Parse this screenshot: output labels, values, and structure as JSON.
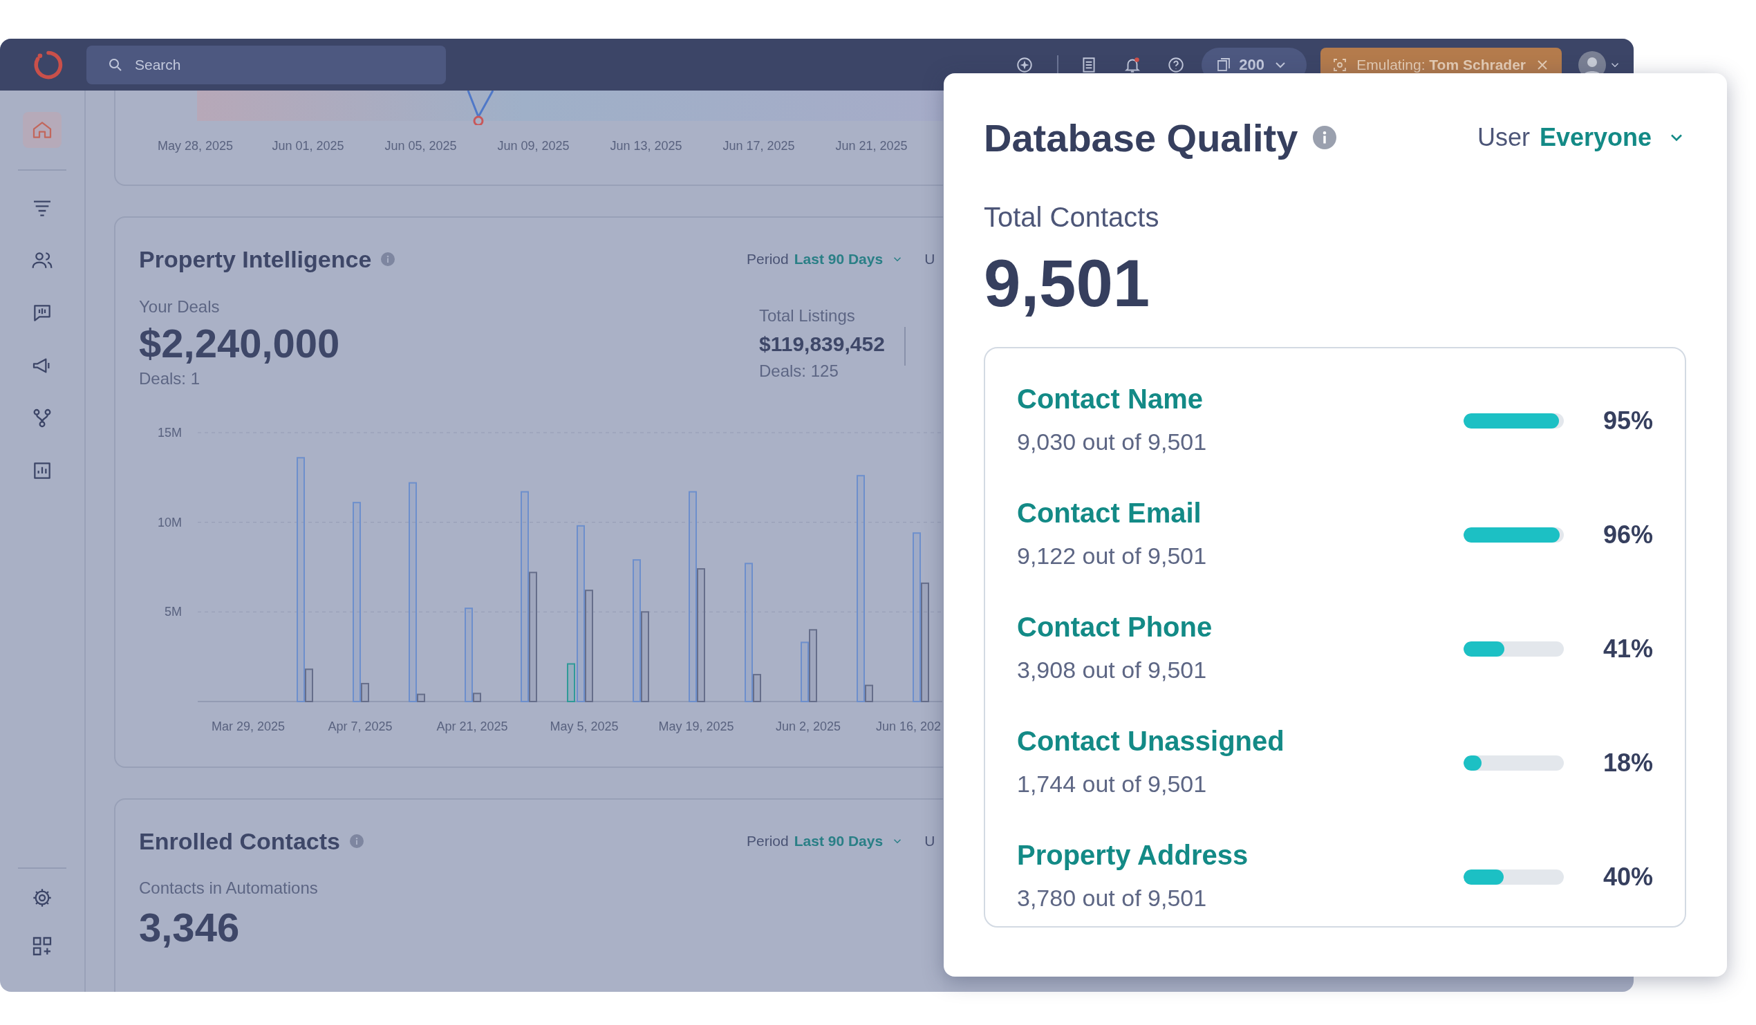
{
  "topbar": {
    "search": {
      "placeholder": "Search"
    },
    "credits": "200",
    "emulating": "Emulating: **Tom Schrader**"
  },
  "sidebar": {
    "items": [
      {
        "selected": true
      },
      {
        "selected": false
      },
      {
        "selected": false
      },
      {
        "selected": false
      },
      {
        "selected": false
      },
      {
        "selected": false
      },
      {
        "selected": false
      }
    ]
  },
  "trend_chart": {
    "x_labels": [
      "May 28, 2025",
      "Jun 01, 2025",
      "Jun 05, 2025",
      "Jun 09, 2025",
      "Jun 13, 2025",
      "Jun 17, 2025",
      "Jun 21, 2025"
    ]
  },
  "property_intelligence": {
    "title": "Property Intelligence",
    "period_label": "Period",
    "period_value": "Last 90 Days",
    "user_label": "U",
    "your_deals_label": "Your Deals",
    "your_deals_value": "$2,240,000",
    "your_deals_count": "Deals: 1",
    "total_listings_label": "Total Listings",
    "total_listings_value": "$119,839,452",
    "total_listings_count": "Deals: 125",
    "chart_data": {
      "type": "bar",
      "categories": [
        "Mar 29, 2025",
        null,
        "Apr 7, 2025",
        null,
        "Apr 21, 2025",
        null,
        "May 5, 2025",
        null,
        "May 19, 2025",
        null,
        "Jun 2, 2025",
        null,
        "Jun 16, 202"
      ],
      "ylim": [
        0,
        15000000
      ],
      "yticks": [
        {
          "value": 5000000,
          "label": "5M"
        },
        {
          "value": 10000000,
          "label": "10M"
        },
        {
          "value": 15000000,
          "label": "15M"
        }
      ],
      "series": [
        {
          "color": "#2f9a98",
          "values": [
            null,
            null,
            null,
            null,
            null,
            null,
            2100000,
            null,
            null,
            null,
            null,
            null,
            null
          ]
        },
        {
          "color": "#6d8fcc",
          "values": [
            null,
            13600000,
            11100000,
            12200000,
            5200000,
            11700000,
            9800000,
            7900000,
            11700000,
            7700000,
            3300000,
            12600000,
            9400000
          ]
        },
        {
          "color": "#666e8a",
          "values": [
            null,
            1800000,
            1000000,
            400000,
            450000,
            7200000,
            6200000,
            5000000,
            7400000,
            1500000,
            4000000,
            900000,
            6600000
          ]
        }
      ]
    }
  },
  "enrolled_contacts": {
    "title": "Enrolled Contacts",
    "period_label": "Period",
    "period_value": "Last 90 Days",
    "user_label": "U",
    "metric_label": "Contacts in Automations",
    "metric_value": "3,346"
  },
  "database_quality": {
    "title": "Database Quality",
    "user_label": "User",
    "user_value": "Everyone",
    "total_label": "Total Contacts",
    "total_value": "9,501",
    "metrics": [
      {
        "name": "Contact Name",
        "detail": "9,030 out of 9,501",
        "level": 0.95,
        "percent": "95%"
      },
      {
        "name": "Contact Email",
        "detail": "9,122 out of 9,501",
        "level": 0.96,
        "percent": "96%"
      },
      {
        "name": "Contact Phone",
        "detail": "3,908 out of 9,501",
        "level": 0.41,
        "percent": "41%"
      },
      {
        "name": "Contact Unassigned",
        "detail": "1,744 out of 9,501",
        "level": 0.18,
        "percent": "18%"
      },
      {
        "name": "Property Address",
        "detail": "3,780 out of 9,501",
        "level": 0.4,
        "percent": "40%"
      }
    ]
  }
}
